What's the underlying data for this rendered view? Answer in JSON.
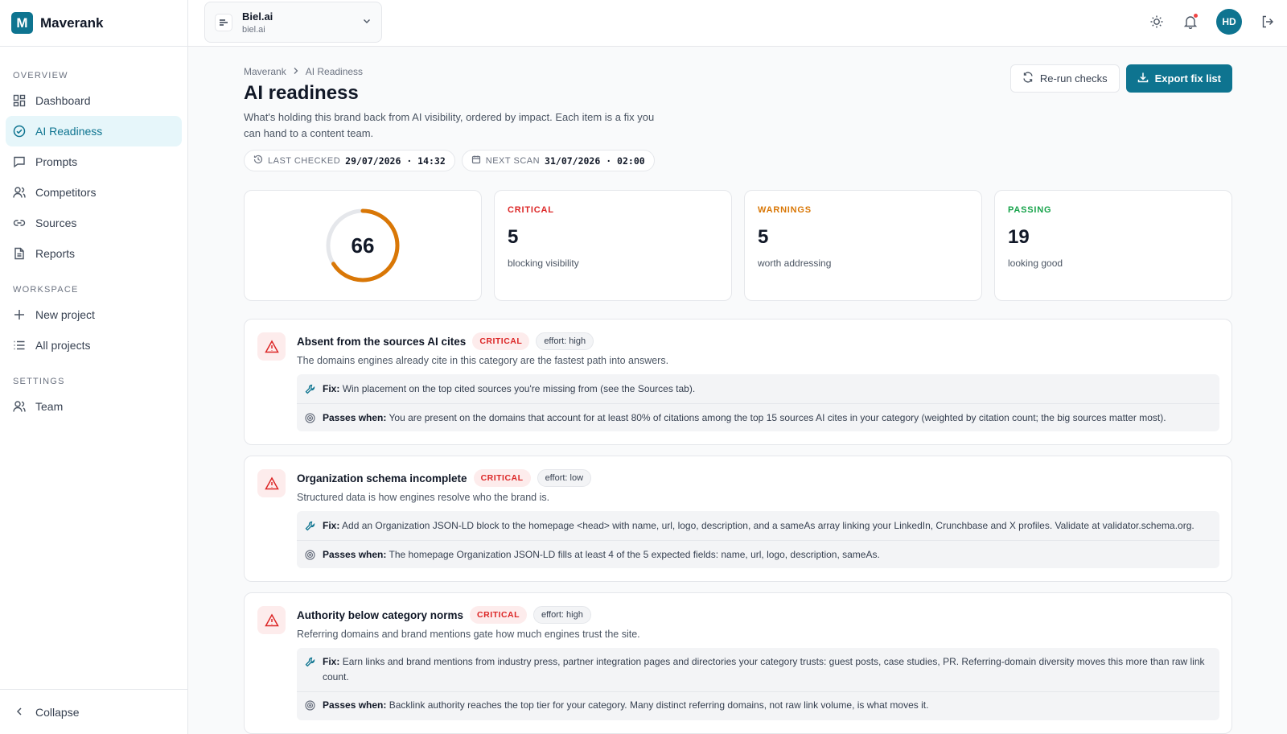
{
  "brand": {
    "name": "Maverank",
    "logo_letter": "M"
  },
  "sidebar": {
    "sections": [
      {
        "heading": "OVERVIEW",
        "items": [
          {
            "label": "Dashboard",
            "icon": "dashboard-icon"
          },
          {
            "label": "AI Readiness",
            "icon": "check-circle-icon",
            "active": true
          },
          {
            "label": "Prompts",
            "icon": "message-icon"
          },
          {
            "label": "Competitors",
            "icon": "users-icon"
          },
          {
            "label": "Sources",
            "icon": "link-icon"
          },
          {
            "label": "Reports",
            "icon": "file-icon"
          }
        ]
      },
      {
        "heading": "WORKSPACE",
        "items": [
          {
            "label": "New project",
            "icon": "plus-icon"
          },
          {
            "label": "All projects",
            "icon": "list-icon"
          }
        ]
      },
      {
        "heading": "SETTINGS",
        "items": [
          {
            "label": "Team",
            "icon": "team-icon"
          }
        ]
      }
    ],
    "collapse_label": "Collapse"
  },
  "topbar": {
    "project_name": "Biel.ai",
    "project_domain": "biel.ai",
    "avatar_initials": "HD"
  },
  "breadcrumb": {
    "root": "Maverank",
    "current": "AI Readiness"
  },
  "page": {
    "title": "AI readiness",
    "description": "What's holding this brand back from AI visibility, ordered by impact. Each item is a fix you can hand to a content team.",
    "rerun_label": "Re-run checks",
    "export_label": "Export fix list",
    "last_checked_label": "LAST CHECKED",
    "last_checked_value": "29/07/2026 · 14:32",
    "next_scan_label": "NEXT SCAN",
    "next_scan_value": "31/07/2026 · 02:00"
  },
  "score": {
    "value": "66",
    "fraction": 0.66,
    "color": "#d97706"
  },
  "stats": [
    {
      "label": "CRITICAL",
      "value": "5",
      "sub": "blocking visibility",
      "color": "#dc2626"
    },
    {
      "label": "WARNINGS",
      "value": "5",
      "sub": "worth addressing",
      "color": "#d97706"
    },
    {
      "label": "PASSING",
      "value": "19",
      "sub": "looking good",
      "color": "#16a34a"
    }
  ],
  "issues": [
    {
      "title": "Absent from the sources AI cites",
      "severity": "CRITICAL",
      "effort": "effort: high",
      "description": "The domains engines already cite in this category are the fastest path into answers.",
      "fix_label": "Fix:",
      "fix": "Win placement on the top cited sources you're missing from (see the Sources tab).",
      "passes_label": "Passes when:",
      "passes": "You are present on the domains that account for at least 80% of citations among the top 15 sources AI cites in your category (weighted by citation count; the big sources matter most)."
    },
    {
      "title": "Organization schema incomplete",
      "severity": "CRITICAL",
      "effort": "effort: low",
      "description": "Structured data is how engines resolve who the brand is.",
      "fix_label": "Fix:",
      "fix": "Add an Organization JSON-LD block to the homepage <head> with name, url, logo, description, and a sameAs array linking your LinkedIn, Crunchbase and X profiles. Validate at validator.schema.org.",
      "passes_label": "Passes when:",
      "passes": "The homepage Organization JSON-LD fills at least 4 of the 5 expected fields: name, url, logo, description, sameAs."
    },
    {
      "title": "Authority below category norms",
      "severity": "CRITICAL",
      "effort": "effort: high",
      "description": "Referring domains and brand mentions gate how much engines trust the site.",
      "fix_label": "Fix:",
      "fix": "Earn links and brand mentions from industry press, partner integration pages and directories your category trusts: guest posts, case studies, PR. Referring-domain diversity moves this more than raw link count.",
      "passes_label": "Passes when:",
      "passes": "Backlink authority reaches the top tier for your category. Many distinct referring domains, not raw link volume, is what moves it."
    }
  ]
}
